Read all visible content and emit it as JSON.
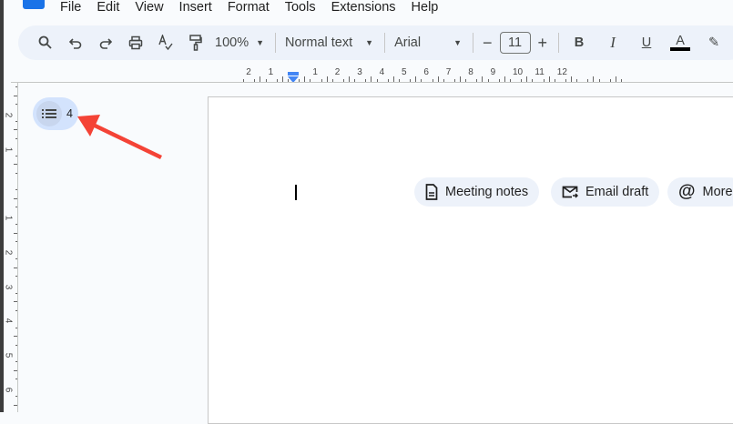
{
  "menu": [
    "File",
    "Edit",
    "View",
    "Insert",
    "Format",
    "Tools",
    "Extensions",
    "Help"
  ],
  "toolbar": {
    "zoom": "100%",
    "style": "Normal text",
    "font": "Arial",
    "font_size": "11",
    "bold": "B",
    "italic": "I",
    "underline": "U",
    "text_color": "A",
    "minus": "−",
    "plus": "+"
  },
  "ruler": {
    "h_labels": [
      "2",
      "1",
      "1",
      "2",
      "3",
      "4",
      "5",
      "6",
      "7",
      "8",
      "9",
      "10",
      "11",
      "12"
    ],
    "v_labels": [
      "2",
      "1",
      "1",
      "2",
      "3",
      "4",
      "5",
      "6"
    ]
  },
  "outline": {
    "count": "4"
  },
  "chips": [
    {
      "label": "Meeting notes",
      "icon": "document-icon"
    },
    {
      "label": "Email draft",
      "icon": "email-icon"
    },
    {
      "label": "More",
      "icon": "at-icon"
    }
  ],
  "colors": {
    "accent": "#1a73e8",
    "arrow": "#f44336"
  }
}
